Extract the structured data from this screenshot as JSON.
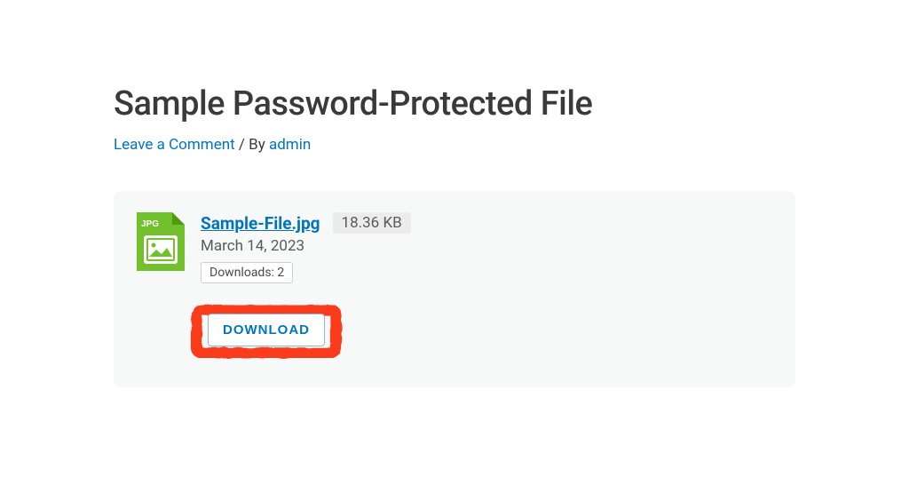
{
  "page": {
    "title": "Sample Password-Protected File"
  },
  "meta": {
    "leave_comment": "Leave a Comment",
    "by_separator": " / By ",
    "author": "admin"
  },
  "file": {
    "icon_type": "JPG",
    "name": "Sample-File.jpg",
    "size": "18.36 KB",
    "date": "March 14, 2023",
    "downloads_label": "Downloads: 2",
    "download_button": "DOWNLOAD"
  },
  "colors": {
    "link": "#0274be",
    "annotation": "#fa3b1d",
    "icon_green": "#72c02c",
    "card_bg": "#f7f8f8"
  }
}
